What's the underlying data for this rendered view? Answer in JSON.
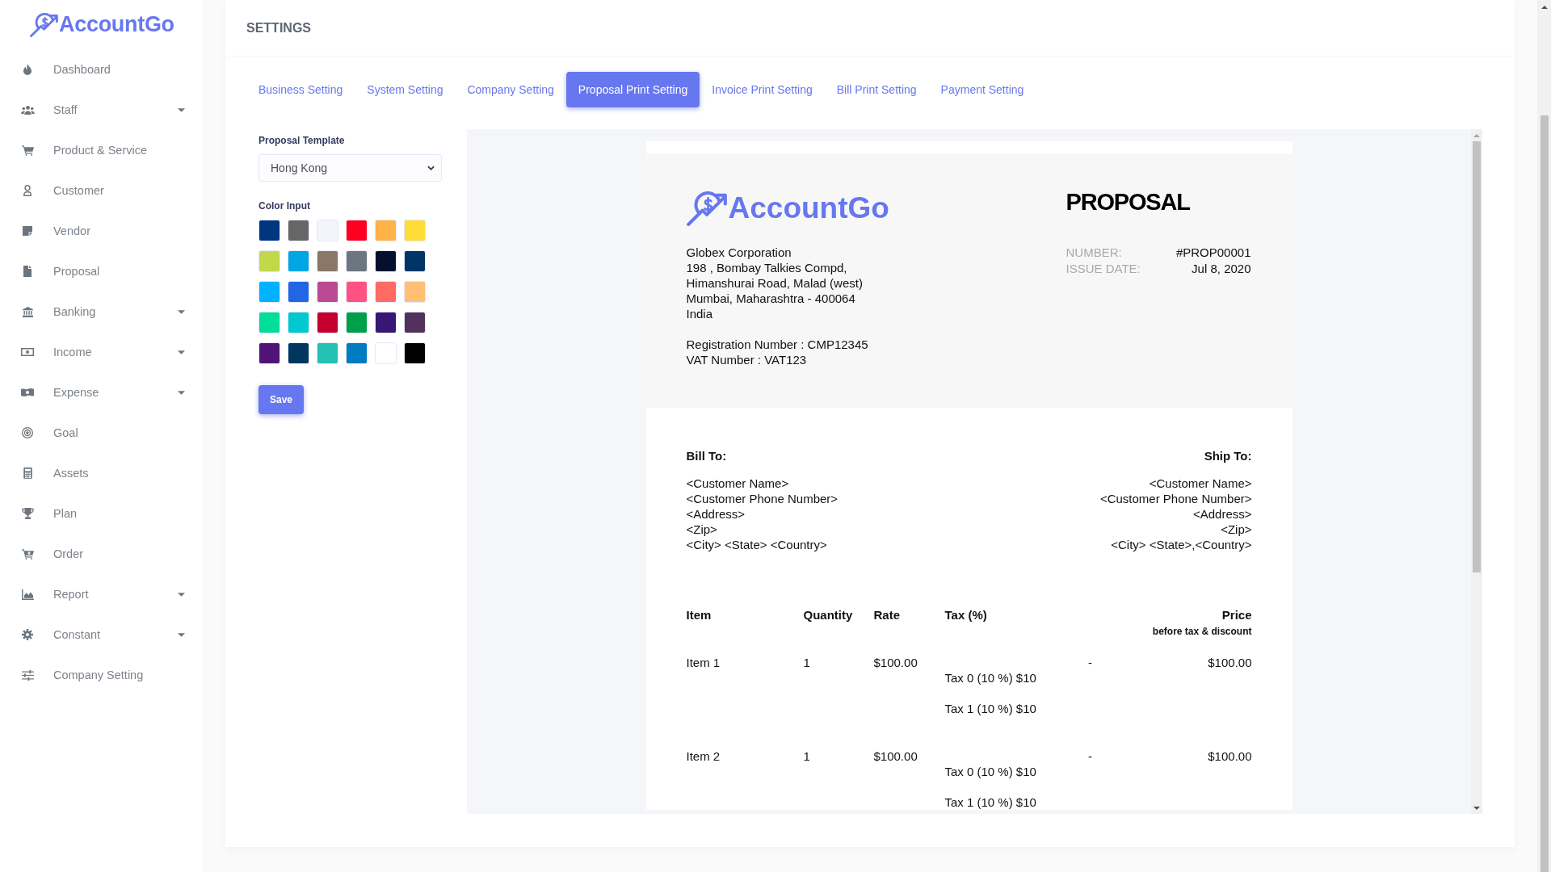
{
  "sidebar": {
    "logo": "AccountGo",
    "items": [
      {
        "label": "Dashboard",
        "has_submenu": false
      },
      {
        "label": "Staff",
        "has_submenu": true
      },
      {
        "label": "Product & Service",
        "has_submenu": false
      },
      {
        "label": "Customer",
        "has_submenu": false
      },
      {
        "label": "Vendor",
        "has_submenu": false
      },
      {
        "label": "Proposal",
        "has_submenu": false
      },
      {
        "label": "Banking",
        "has_submenu": true
      },
      {
        "label": "Income",
        "has_submenu": true
      },
      {
        "label": "Expense",
        "has_submenu": true
      },
      {
        "label": "Goal",
        "has_submenu": false
      },
      {
        "label": "Assets",
        "has_submenu": false
      },
      {
        "label": "Plan",
        "has_submenu": false
      },
      {
        "label": "Order",
        "has_submenu": false
      },
      {
        "label": "Report",
        "has_submenu": true
      },
      {
        "label": "Constant",
        "has_submenu": true
      },
      {
        "label": "Company Setting",
        "has_submenu": false
      }
    ]
  },
  "header": {
    "title": "SETTINGS"
  },
  "tabs": [
    {
      "label": "Business Setting",
      "selected": false
    },
    {
      "label": "System Setting",
      "selected": false
    },
    {
      "label": "Company Setting",
      "selected": false
    },
    {
      "label": "Proposal Print Setting",
      "selected": true
    },
    {
      "label": "Invoice Print Setting",
      "selected": false
    },
    {
      "label": "Bill Print Setting",
      "selected": false
    },
    {
      "label": "Payment Setting",
      "selected": false
    }
  ],
  "form": {
    "template_label": "Proposal Template",
    "template_value": "Hong Kong",
    "color_label": "Color Input",
    "swatches": [
      {
        "color": "#003580"
      },
      {
        "color": "#666666"
      },
      {
        "color": "#f2f6fa"
      },
      {
        "color": "#ff0021"
      },
      {
        "color": "#ffb246"
      },
      {
        "color": "#ffdd36"
      },
      {
        "color": "#c1d84a"
      },
      {
        "color": "#00a5e3"
      },
      {
        "color": "#8b7766"
      },
      {
        "color": "#6b7680"
      },
      {
        "color": "#04112e"
      },
      {
        "color": "#003566"
      },
      {
        "color": "#00b2ff"
      },
      {
        "color": "#2166e3"
      },
      {
        "color": "#bb4a92"
      },
      {
        "color": "#ff5284"
      },
      {
        "color": "#ff6b63"
      },
      {
        "color": "#ffc075"
      },
      {
        "color": "#00de9a"
      },
      {
        "color": "#00c8d1"
      },
      {
        "color": "#c3002f"
      },
      {
        "color": "#00a049"
      },
      {
        "color": "#371675"
      },
      {
        "color": "#52325d"
      },
      {
        "color": "#511378"
      },
      {
        "color": "#003660"
      },
      {
        "color": "#24c1b5"
      },
      {
        "color": "#007cc0"
      },
      {
        "color": "#ffffff"
      },
      {
        "color": "#000000"
      }
    ],
    "save_button": "Save"
  },
  "proposal": {
    "logo": "AccountGo",
    "title": "PROPOSAL",
    "company_lines": [
      "Globex Corporation",
      "198 , Bombay Talkies Compd,",
      "Himanshurai Road, Malad (west)",
      "Mumbai, Maharashtra - 400064",
      "India"
    ],
    "registration_lines": [
      "Registration Number : CMP12345",
      "VAT Number : VAT123"
    ],
    "meta": [
      {
        "label": "NUMBER:",
        "value": "#PROP00001"
      },
      {
        "label": "ISSUE DATE:",
        "value": "Jul 8, 2020"
      }
    ],
    "bill_to": {
      "title": "Bill To:",
      "lines": [
        "<Customer Name>",
        "<Customer Phone Number>",
        "<Address>",
        "<Zip>",
        "<City> <State> <Country>"
      ]
    },
    "ship_to": {
      "title": "Ship To:",
      "lines": [
        "<Customer Name>",
        "<Customer Phone Number>",
        "<Address>",
        "<Zip>",
        "<City> <State>,<Country>"
      ]
    },
    "table": {
      "columns": {
        "item": "Item",
        "quantity": "Quantity",
        "rate": "Rate",
        "tax": "Tax (%)",
        "price": "Price",
        "price_note": "before tax & discount"
      },
      "rows": [
        {
          "item": "Item 1",
          "quantity": "1",
          "rate": "$100.00",
          "taxes": [
            "Tax 0 (10 %) $10",
            "Tax 1 (10 %) $10"
          ],
          "column_5": "-",
          "price": "$100.00"
        },
        {
          "item": "Item 2",
          "quantity": "1",
          "rate": "$100.00",
          "taxes": [
            "Tax 0 (10 %) $10",
            "Tax 1 (10 %) $10"
          ],
          "column_5": "-",
          "price": "$100.00"
        }
      ]
    }
  }
}
